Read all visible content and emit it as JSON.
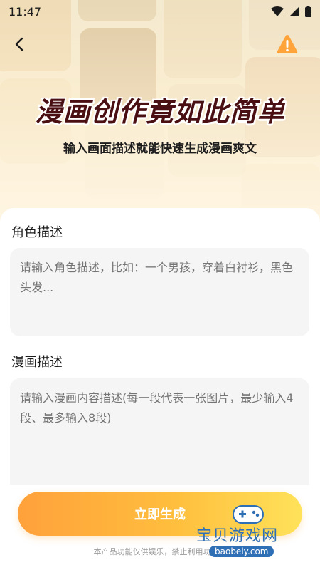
{
  "status_bar": {
    "time": "11:47"
  },
  "hero": {
    "title": "漫画创作竟如此简单",
    "subtitle": "输入画面描述就能快速生成漫画爽文"
  },
  "icons": {
    "back": "back-arrow-icon",
    "warning": "warning-icon",
    "wifi": "wifi-icon",
    "signal": "signal-icon",
    "battery": "battery-icon"
  },
  "colors": {
    "title": "#4a0f12",
    "accent_start": "#ffa13c",
    "accent_end": "#ffe25a",
    "warning": "#ffa43b"
  },
  "form": {
    "character": {
      "label": "角色描述",
      "value": "",
      "placeholder": "请输入角色描述，比如：一个男孩，穿着白衬衫，黑色头发..."
    },
    "comic": {
      "label": "漫画描述",
      "value": "",
      "placeholder": "请输入漫画内容描述(每一段代表一张图片，最少输入4段、最多输入8段)"
    }
  },
  "generate_button": "立即生成",
  "disclaimer": "本产品功能仅供娱乐，禁止利用功能从",
  "watermark": {
    "text": "宝贝游戏网",
    "url": "baobeiy.com"
  }
}
